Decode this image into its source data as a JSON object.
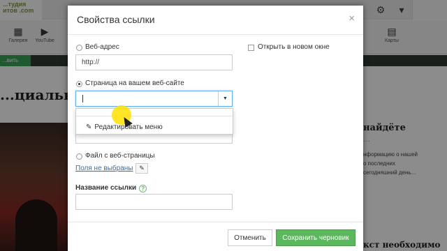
{
  "background": {
    "logo_text": "...тудия\nитов\n.com",
    "toolbar_tools": [
      {
        "icon": "grid-icon",
        "label": "Галерея"
      },
      {
        "icon": "youtube-icon",
        "label": "YouTube"
      },
      {
        "icon": "map-icon",
        "label": "Карты"
      }
    ],
    "left_green_label": "...вить",
    "page_heading": "...циальное П",
    "right_title": "найдёте",
    "right_dots": "...",
    "right_lines": [
      "нформацию о нашей",
      "о последних",
      "сегодняшний день..."
    ],
    "right_bottom": "кст необходимо"
  },
  "dialog": {
    "title": "Свойства ссылки",
    "close_glyph": "×",
    "option_web": {
      "label": "Веб-адрес",
      "value": "http://"
    },
    "option_page": {
      "label": "Страница на вашем веб-сайте",
      "select_value": ""
    },
    "dropdown_item": "Редактировать меню",
    "open_new_window": "Открыть в новом окне",
    "option_file": {
      "label": "Файл с веб-страницы",
      "link": "Поля не выбраны"
    },
    "link_name": {
      "label": "Название ссылки",
      "help": "?",
      "value": ""
    },
    "buttons": {
      "cancel": "Отменить",
      "save": "Сохранить черновик"
    }
  },
  "colors": {
    "save_button": "#5cb85c",
    "cursor_highlight": "#ffe100"
  }
}
